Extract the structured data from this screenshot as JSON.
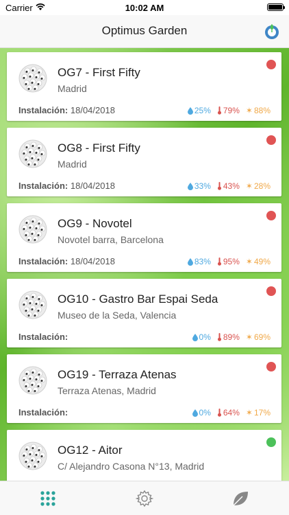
{
  "status_bar": {
    "carrier": "Carrier",
    "time": "10:02 AM"
  },
  "nav": {
    "title": "Optimus Garden"
  },
  "install_label": "Instalación:",
  "colors": {
    "red": "#e05454",
    "green": "#4cc15a"
  },
  "gardens": [
    {
      "title": "OG7 - First Fifty",
      "subtitle": "Madrid",
      "install_date": "18/04/2018",
      "humidity": "25%",
      "temperature": "79%",
      "light": "88%",
      "status": "red"
    },
    {
      "title": "OG8 - First Fifty",
      "subtitle": "Madrid",
      "install_date": "18/04/2018",
      "humidity": "33%",
      "temperature": "43%",
      "light": "28%",
      "status": "red"
    },
    {
      "title": "OG9 - Novotel",
      "subtitle": "Novotel barra, Barcelona",
      "install_date": "18/04/2018",
      "humidity": "83%",
      "temperature": "95%",
      "light": "49%",
      "status": "red"
    },
    {
      "title": "OG10 - Gastro Bar Espai Seda",
      "subtitle": "Museo de la Seda, Valencia",
      "install_date": "",
      "humidity": "0%",
      "temperature": "89%",
      "light": "69%",
      "status": "red"
    },
    {
      "title": "OG19 - Terraza Atenas",
      "subtitle": "Terraza Atenas, Madrid",
      "install_date": "",
      "humidity": "0%",
      "temperature": "64%",
      "light": "17%",
      "status": "red"
    },
    {
      "title": "OG12 - Aitor",
      "subtitle": "C/ Alejandro Casona N°13, Madrid",
      "install_date": "",
      "humidity": "",
      "temperature": "",
      "light": "",
      "status": "green"
    }
  ],
  "tabs": [
    {
      "name": "gardens",
      "icon": "grid-icon",
      "active": true
    },
    {
      "name": "settings",
      "icon": "gear-icon",
      "active": false
    },
    {
      "name": "leaf",
      "icon": "leaf-icon",
      "active": false
    }
  ]
}
